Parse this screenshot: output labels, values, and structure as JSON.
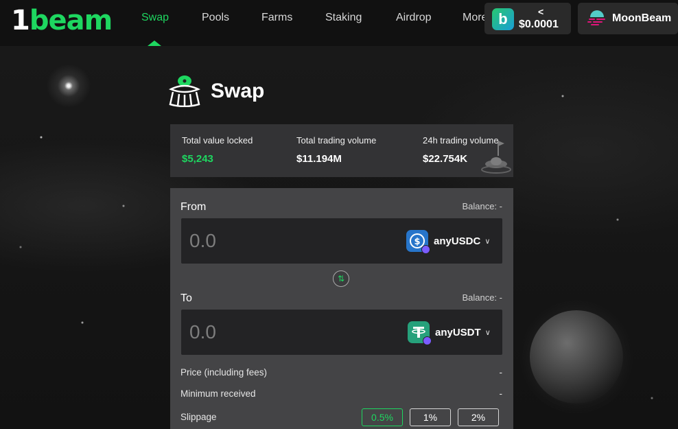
{
  "brand": {
    "logo_one": "1",
    "logo_text": "beam"
  },
  "nav": {
    "items": [
      {
        "label": "Swap",
        "active": true
      },
      {
        "label": "Pools"
      },
      {
        "label": "Farms"
      },
      {
        "label": "Staking"
      },
      {
        "label": "Airdrop"
      },
      {
        "label": "More"
      }
    ]
  },
  "token_price": {
    "chevron": "<",
    "value": "$0.0001",
    "icon": "beam-logo-icon"
  },
  "network": {
    "label": "MoonBeam",
    "icon": "moonbeam-icon"
  },
  "page": {
    "title": "Swap",
    "icon": "ufo-icon"
  },
  "stats": {
    "tvl_label": "Total value locked",
    "tvl_value": "$5,243",
    "total_volume_label": "Total trading volume",
    "total_volume_value": "$11.194M",
    "daily_volume_label": "24h trading volume",
    "daily_volume_value": "$22.754K"
  },
  "swap": {
    "from_label": "From",
    "from_balance": "Balance: -",
    "from_amount_placeholder": "0.0",
    "from_token": "anyUSDC",
    "to_label": "To",
    "to_balance": "Balance: -",
    "to_amount_placeholder": "0.0",
    "to_token": "anyUSDT",
    "price_label": "Price (including fees)",
    "price_value": "-",
    "min_received_label": "Minimum received",
    "min_received_value": "-",
    "slippage_label": "Slippage",
    "slippage_options": [
      "0.5%",
      "1%",
      "2%"
    ],
    "slippage_selected": "0.5%"
  },
  "colors": {
    "accent": "#1ed760",
    "card": "#444446",
    "stats": "#333335",
    "input": "#232325"
  }
}
